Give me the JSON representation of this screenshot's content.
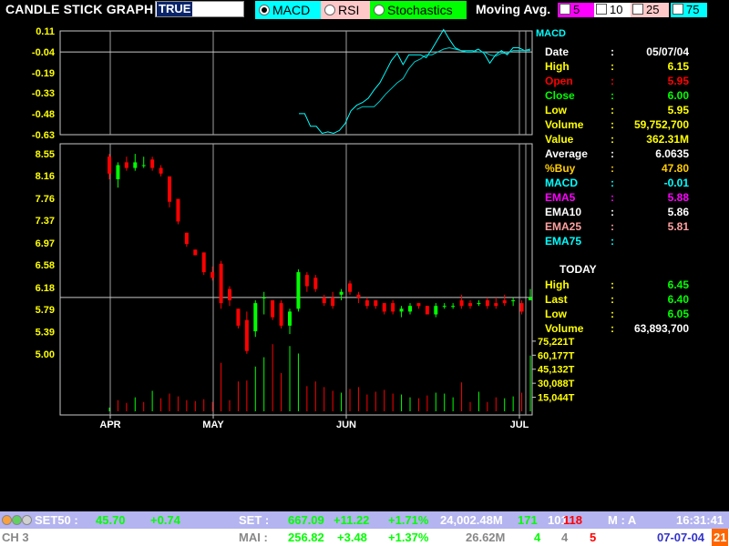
{
  "header": {
    "title": "CANDLE STICK GRAPH",
    "input_value": "TRUE",
    "indicators": [
      {
        "label": "MACD",
        "selected": true,
        "color": "#00ffff"
      },
      {
        "label": "RSI",
        "selected": false,
        "color": "#ffc8c8"
      },
      {
        "label": "Stochastics",
        "selected": false,
        "color": "#00ff00"
      }
    ],
    "moving_avg_label": "Moving Avg.",
    "moving_avgs": [
      {
        "label": "5",
        "color": "#ff00ff"
      },
      {
        "label": "10",
        "color": "#ffffff"
      },
      {
        "label": "25",
        "color": "#ffc8c8"
      },
      {
        "label": "75",
        "color": "#00ffff"
      }
    ]
  },
  "info": {
    "macd_title": "MACD",
    "rows": [
      {
        "key": "Date",
        "value": "05/07/04",
        "color": "#ffffff",
        "vcolor": "#ffffff"
      },
      {
        "key": "High",
        "value": "6.15",
        "color": "#ffff00",
        "vcolor": "#ffff00"
      },
      {
        "key": "Open",
        "value": "5.95",
        "color": "#ff0000",
        "vcolor": "#ff0000"
      },
      {
        "key": "Close",
        "value": "6.00",
        "color": "#00ff00",
        "vcolor": "#00ff00"
      },
      {
        "key": "Low",
        "value": "5.95",
        "color": "#ffff00",
        "vcolor": "#ffff00"
      },
      {
        "key": "Volume",
        "value": "59,752,700",
        "color": "#ffff00",
        "vcolor": "#ffff00"
      },
      {
        "key": "Value",
        "value": "362.31M",
        "color": "#ffff00",
        "vcolor": "#ffff00"
      },
      {
        "key": "Average",
        "value": "6.0635",
        "color": "#ffffff",
        "vcolor": "#ffffff"
      },
      {
        "key": "%Buy",
        "value": "47.80",
        "color": "#ffcc00",
        "vcolor": "#ffcc00"
      },
      {
        "key": "MACD",
        "value": "-0.01",
        "color": "#00ffff",
        "vcolor": "#00ffff"
      },
      {
        "key": "EMA5",
        "value": "5.88",
        "color": "#ff00ff",
        "vcolor": "#ff00ff"
      },
      {
        "key": "EMA10",
        "value": "5.86",
        "color": "#ffffff",
        "vcolor": "#ffffff"
      },
      {
        "key": "EMA25",
        "value": "5.81",
        "color": "#ffa0a0",
        "vcolor": "#ffa0a0"
      },
      {
        "key": "EMA75",
        "value": "",
        "color": "#00ffff",
        "vcolor": "#00ffff"
      }
    ],
    "today_title": "TODAY",
    "today_rows": [
      {
        "key": "High",
        "value": "6.45",
        "color": "#ffff00",
        "vcolor": "#00ff00"
      },
      {
        "key": "Last",
        "value": "6.40",
        "color": "#ffff00",
        "vcolor": "#00ff00"
      },
      {
        "key": "Low",
        "value": "6.05",
        "color": "#ffff00",
        "vcolor": "#00ff00"
      },
      {
        "key": "Volume",
        "value": "63,893,700",
        "color": "#ffff00",
        "vcolor": "#ffffff"
      }
    ]
  },
  "ticker": {
    "row1": [
      {
        "text": "SET50 :",
        "color": "#ffffff"
      },
      {
        "text": "45.70",
        "color": "#00ff00"
      },
      {
        "text": "+0.74",
        "color": "#00ff00"
      },
      {
        "text": "SET :",
        "color": "#ffffff"
      },
      {
        "text": "667.09",
        "color": "#00ff00"
      },
      {
        "text": "+11.22",
        "color": "#00ff00"
      },
      {
        "text": "+1.71%",
        "color": "#00ff00"
      },
      {
        "text": "24,002.48M",
        "color": "#ffffff"
      },
      {
        "text": "171",
        "color": "#00ff00"
      },
      {
        "text": "101",
        "color": "#ffffff"
      },
      {
        "text": "118",
        "color": "#ff0000"
      },
      {
        "text": "M : A",
        "color": "#ffffff"
      },
      {
        "text": "16:31:41",
        "color": "#ffffff"
      }
    ],
    "row2": [
      {
        "text": "CH 3",
        "color": "#888888"
      },
      {
        "text": "MAI :",
        "color": "#888888"
      },
      {
        "text": "256.82",
        "color": "#00ff00"
      },
      {
        "text": "+3.48",
        "color": "#00ff00"
      },
      {
        "text": "+1.37%",
        "color": "#00ff00"
      },
      {
        "text": "26.62M",
        "color": "#888888"
      },
      {
        "text": "4",
        "color": "#00ff00"
      },
      {
        "text": "4",
        "color": "#888888"
      },
      {
        "text": "5",
        "color": "#ff0000"
      },
      {
        "text": "07-07-04",
        "color": "#3333cc"
      },
      {
        "text": "21",
        "color": "#ffffff"
      }
    ]
  },
  "chart_data": [
    {
      "type": "line",
      "title": "MACD",
      "ylim": [
        -0.63,
        0.11
      ],
      "yticks": [
        "0.11",
        "-0.04",
        "-0.19",
        "-0.33",
        "-0.48",
        "-0.63"
      ],
      "x_months": [
        "APR",
        "MAY",
        "JUN",
        "JUL"
      ],
      "series": [
        {
          "name": "MACD",
          "color": "#00ffff",
          "values": [
            -0.48,
            -0.48,
            -0.57,
            -0.57,
            -0.62,
            -0.61,
            -0.62,
            -0.6,
            -0.55,
            -0.46,
            -0.42,
            -0.4,
            -0.37,
            -0.31,
            -0.26,
            -0.18,
            -0.1,
            -0.05,
            -0.13,
            -0.06,
            -0.06,
            -0.06,
            -0.08,
            -0.02,
            0.05,
            0.12,
            0.05,
            -0.01,
            -0.03,
            -0.04,
            -0.04,
            -0.02,
            -0.05,
            -0.12,
            -0.06,
            -0.03,
            -0.06,
            -0.01,
            -0.01,
            -0.03,
            -0.02
          ]
        },
        {
          "name": "Signal",
          "color": "#00cccc",
          "values": [
            null,
            null,
            null,
            null,
            null,
            null,
            null,
            null,
            null,
            null,
            -0.45,
            -0.43,
            -0.43,
            -0.43,
            -0.39,
            -0.34,
            -0.3,
            -0.26,
            -0.23,
            -0.16,
            -0.11,
            -0.09,
            -0.06,
            -0.06,
            -0.04,
            -0.02,
            -0.01,
            -0.02,
            -0.03,
            -0.03,
            -0.03,
            -0.04,
            -0.04,
            -0.06,
            -0.07,
            -0.05,
            -0.05,
            -0.03,
            -0.03,
            -0.03,
            -0.03
          ]
        }
      ]
    },
    {
      "type": "candlestick",
      "ylim": [
        4.9,
        8.6
      ],
      "yticks": [
        "8.55",
        "8.16",
        "7.76",
        "7.37",
        "6.97",
        "6.58",
        "6.18",
        "5.79",
        "5.39",
        "5.00"
      ],
      "x_months": [
        "APR",
        "MAY",
        "JUN",
        "JUL"
      ],
      "reference_line": 6.0,
      "candles": [
        {
          "o": 8.5,
          "h": 8.55,
          "l": 8.1,
          "c": 8.2
        },
        {
          "o": 8.1,
          "h": 8.4,
          "l": 7.95,
          "c": 8.35
        },
        {
          "o": 8.4,
          "h": 8.5,
          "l": 8.25,
          "c": 8.3
        },
        {
          "o": 8.3,
          "h": 8.55,
          "l": 8.25,
          "c": 8.4
        },
        {
          "o": 8.35,
          "h": 8.5,
          "l": 8.3,
          "c": 8.35
        },
        {
          "o": 8.45,
          "h": 8.5,
          "l": 8.25,
          "c": 8.3
        },
        {
          "o": 8.3,
          "h": 8.35,
          "l": 8.15,
          "c": 8.2
        },
        {
          "o": 8.15,
          "h": 8.15,
          "l": 7.6,
          "c": 7.7
        },
        {
          "o": 7.75,
          "h": 7.75,
          "l": 7.3,
          "c": 7.35
        },
        {
          "o": 7.15,
          "h": 7.15,
          "l": 6.9,
          "c": 6.95
        },
        {
          "o": 6.85,
          "h": 6.85,
          "l": 6.75,
          "c": 6.75
        },
        {
          "o": 6.8,
          "h": 6.8,
          "l": 6.4,
          "c": 6.45
        },
        {
          "o": 6.45,
          "h": 6.55,
          "l": 6.3,
          "c": 6.35
        },
        {
          "o": 6.6,
          "h": 6.65,
          "l": 5.8,
          "c": 5.9
        },
        {
          "o": 6.15,
          "h": 6.2,
          "l": 5.85,
          "c": 5.95
        },
        {
          "o": 5.8,
          "h": 5.8,
          "l": 5.45,
          "c": 5.5
        },
        {
          "o": 5.6,
          "h": 5.75,
          "l": 5.0,
          "c": 5.05
        },
        {
          "o": 5.4,
          "h": 5.95,
          "l": 5.3,
          "c": 5.9
        },
        {
          "o": 5.99,
          "h": 6.1,
          "l": 5.7,
          "c": 6.0
        },
        {
          "o": 5.95,
          "h": 5.95,
          "l": 5.6,
          "c": 5.65
        },
        {
          "o": 5.9,
          "h": 5.95,
          "l": 5.45,
          "c": 5.5
        },
        {
          "o": 5.5,
          "h": 5.8,
          "l": 5.35,
          "c": 5.75
        },
        {
          "o": 5.8,
          "h": 6.5,
          "l": 5.75,
          "c": 6.45
        },
        {
          "o": 6.4,
          "h": 6.45,
          "l": 6.1,
          "c": 6.2
        },
        {
          "o": 6.35,
          "h": 6.4,
          "l": 6.1,
          "c": 6.15
        },
        {
          "o": 6.0,
          "h": 6.05,
          "l": 5.85,
          "c": 5.9
        },
        {
          "o": 6.0,
          "h": 6.1,
          "l": 5.8,
          "c": 5.85
        },
        {
          "o": 6.05,
          "h": 6.15,
          "l": 5.95,
          "c": 6.1
        },
        {
          "o": 6.25,
          "h": 6.3,
          "l": 6.05,
          "c": 6.1
        },
        {
          "o": 6.05,
          "h": 6.1,
          "l": 5.9,
          "c": 6.0
        },
        {
          "o": 5.95,
          "h": 6.0,
          "l": 5.8,
          "c": 5.85
        },
        {
          "o": 5.95,
          "h": 5.95,
          "l": 5.8,
          "c": 5.85
        },
        {
          "o": 5.9,
          "h": 5.9,
          "l": 5.7,
          "c": 5.75
        },
        {
          "o": 5.9,
          "h": 5.95,
          "l": 5.7,
          "c": 5.75
        },
        {
          "o": 5.75,
          "h": 5.85,
          "l": 5.65,
          "c": 5.8
        },
        {
          "o": 5.75,
          "h": 5.9,
          "l": 5.7,
          "c": 5.85
        },
        {
          "o": 5.9,
          "h": 5.9,
          "l": 5.8,
          "c": 5.85
        },
        {
          "o": 5.85,
          "h": 5.85,
          "l": 5.7,
          "c": 5.7
        },
        {
          "o": 5.7,
          "h": 5.9,
          "l": 5.65,
          "c": 5.85
        },
        {
          "o": 5.85,
          "h": 5.9,
          "l": 5.8,
          "c": 5.85
        },
        {
          "o": 5.85,
          "h": 5.9,
          "l": 5.8,
          "c": 5.85
        },
        {
          "o": 5.95,
          "h": 6.05,
          "l": 5.8,
          "c": 5.85
        },
        {
          "o": 5.9,
          "h": 5.95,
          "l": 5.8,
          "c": 5.85
        },
        {
          "o": 5.9,
          "h": 5.95,
          "l": 5.85,
          "c": 5.9
        },
        {
          "o": 5.95,
          "h": 6.0,
          "l": 5.8,
          "c": 5.85
        },
        {
          "o": 5.9,
          "h": 6.0,
          "l": 5.8,
          "c": 5.85
        },
        {
          "o": 5.95,
          "h": 6.05,
          "l": 5.85,
          "c": 5.9
        },
        {
          "o": 5.95,
          "h": 6.0,
          "l": 5.85,
          "c": 5.95
        },
        {
          "o": 5.9,
          "h": 5.95,
          "l": 5.7,
          "c": 5.75
        },
        {
          "o": 5.95,
          "h": 6.15,
          "l": 5.95,
          "c": 6.0
        }
      ]
    },
    {
      "type": "bar",
      "title": "Volume",
      "ylim": [
        0,
        80000
      ],
      "yticks": [
        "75,221T",
        "60,177T",
        "45,132T",
        "30,088T",
        "15,044T"
      ],
      "values": [
        4000,
        12000,
        9000,
        15000,
        10000,
        22000,
        14000,
        19000,
        16000,
        12000,
        11000,
        13000,
        10000,
        52000,
        12000,
        32000,
        33000,
        48000,
        58000,
        72000,
        41000,
        70000,
        62000,
        27000,
        32000,
        26000,
        22000,
        20000,
        24000,
        26000,
        18000,
        21000,
        23000,
        19000,
        18000,
        15000,
        14000,
        17000,
        20000,
        19000,
        15000,
        31000,
        10000,
        21000,
        10000,
        15000,
        14000,
        16000,
        20000,
        59752
      ],
      "colors": [
        "g",
        "r",
        "r",
        "g",
        "r",
        "g",
        "r",
        "r",
        "r",
        "r",
        "r",
        "r",
        "r",
        "r",
        "r",
        "r",
        "r",
        "g",
        "g",
        "r",
        "r",
        "g",
        "g",
        "r",
        "r",
        "r",
        "r",
        "g",
        "r",
        "r",
        "r",
        "r",
        "r",
        "r",
        "g",
        "g",
        "r",
        "r",
        "g",
        "g",
        "g",
        "r",
        "r",
        "g",
        "r",
        "r",
        "g",
        "g",
        "r",
        "g"
      ]
    }
  ]
}
